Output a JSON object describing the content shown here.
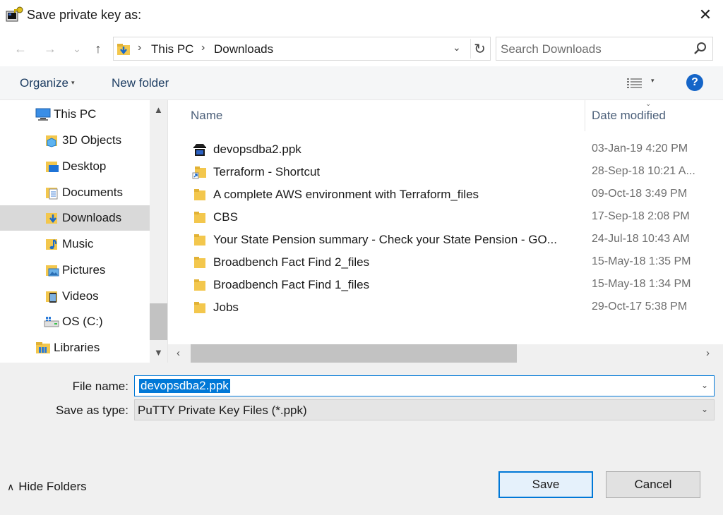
{
  "window": {
    "title": "Save private key as:",
    "close_glyph": "✕",
    "app_icon": "putty-key-icon"
  },
  "nav": {
    "back_glyph": "←",
    "forward_glyph": "→",
    "recent_glyph": "⌄",
    "up_glyph": "↑",
    "breadcrumb": [
      "This PC",
      "Downloads"
    ],
    "crumb_sep": "›",
    "dropdown_glyph": "⌄",
    "refresh_glyph": "↻",
    "search_placeholder": "Search Downloads"
  },
  "toolbar": {
    "organize_label": "Organize",
    "organize_caret": "▾",
    "new_folder_label": "New folder",
    "view_caret": "▾",
    "help_glyph": "?"
  },
  "navpane": {
    "items": [
      {
        "label": "This PC",
        "icon": "computer-icon"
      },
      {
        "label": "3D Objects",
        "icon": "3d-objects-icon"
      },
      {
        "label": "Desktop",
        "icon": "desktop-icon"
      },
      {
        "label": "Documents",
        "icon": "documents-icon"
      },
      {
        "label": "Downloads",
        "icon": "downloads-icon"
      },
      {
        "label": "Music",
        "icon": "music-icon"
      },
      {
        "label": "Pictures",
        "icon": "pictures-icon"
      },
      {
        "label": "Videos",
        "icon": "videos-icon"
      },
      {
        "label": "OS (C:)",
        "icon": "drive-icon"
      },
      {
        "label": "Libraries",
        "icon": "libraries-icon"
      }
    ],
    "selected": "Downloads",
    "scroll_up_glyph": "▲",
    "scroll_down_glyph": "▼"
  },
  "filelist": {
    "columns": {
      "name": "Name",
      "date": "Date modified"
    },
    "sort_caret": "⌄",
    "rows": [
      {
        "name": "devopsdba2.ppk",
        "date": "03-Jan-19 4:20 PM",
        "icon": "putty-file-icon"
      },
      {
        "name": "Terraform - Shortcut",
        "date": "28-Sep-18 10:21 A...",
        "icon": "shortcut-icon"
      },
      {
        "name": "A complete AWS environment with Terraform_files",
        "date": "09-Oct-18 3:49 PM",
        "icon": "folder-icon"
      },
      {
        "name": "CBS",
        "date": "17-Sep-18 2:08 PM",
        "icon": "folder-icon"
      },
      {
        "name": "Your State Pension summary - Check your State Pension - GO...",
        "date": "24-Jul-18 10:43 AM",
        "icon": "folder-icon"
      },
      {
        "name": "Broadbench Fact Find 2_files",
        "date": "15-May-18 1:35 PM",
        "icon": "folder-icon"
      },
      {
        "name": "Broadbench Fact Find 1_files",
        "date": "15-May-18 1:34 PM",
        "icon": "folder-icon"
      },
      {
        "name": "Jobs",
        "date": "29-Oct-17 5:38 PM",
        "icon": "folder-icon"
      }
    ],
    "scroll_left_glyph": "‹",
    "scroll_right_glyph": "›"
  },
  "form": {
    "filename_label": "File name:",
    "filename_value": "devopsdba2.ppk",
    "savetype_label": "Save as type:",
    "savetype_value": "PuTTY Private Key Files (*.ppk)",
    "combo_caret": "⌄"
  },
  "footer": {
    "hide_folders_chev": "∧",
    "hide_folders_label": "Hide Folders",
    "save_label": "Save",
    "cancel_label": "Cancel"
  },
  "colors": {
    "accent": "#0078d7",
    "folder": "#f3c74d",
    "help": "#1565c8"
  }
}
